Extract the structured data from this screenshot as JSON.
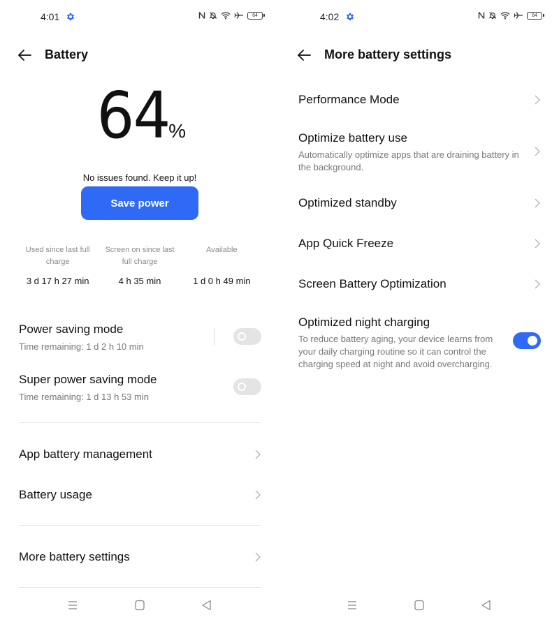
{
  "left": {
    "status": {
      "time": "4:01",
      "battery_level": "64",
      "icons": [
        "settings-gear-icon",
        "nfc-icon",
        "notifications-off-icon",
        "wifi-icon",
        "airplane-mode-icon",
        "battery-icon"
      ]
    },
    "header": {
      "title": "Battery"
    },
    "battery": {
      "percent": "64",
      "percent_sign": "%",
      "status_text": "No issues found. Keep it up!",
      "save_power_label": "Save power"
    },
    "stats": [
      {
        "label": "Used since last full charge",
        "value": "3 d 17 h 27 min"
      },
      {
        "label": "Screen on since last full charge",
        "value": "4 h 35 min"
      },
      {
        "label": "Available",
        "value": "1 d 0 h 49 min"
      }
    ],
    "modes": [
      {
        "title": "Power saving mode",
        "subtitle": "Time remaining:  1 d 2 h 10 min",
        "enabled": false
      },
      {
        "title": "Super power saving mode",
        "subtitle": "Time remaining:  1 d 13 h 53 min",
        "enabled": false
      }
    ],
    "menu": [
      {
        "label": "App battery management"
      },
      {
        "label": "Battery usage"
      },
      {
        "label": "More battery settings"
      }
    ]
  },
  "right": {
    "status": {
      "time": "4:02",
      "battery_level": "64"
    },
    "header": {
      "title": "More battery settings"
    },
    "items": [
      {
        "title": "Performance Mode"
      },
      {
        "title": "Optimize battery use",
        "subtitle": "Automatically optimize apps that are draining battery in the background."
      },
      {
        "title": "Optimized standby"
      },
      {
        "title": "App Quick Freeze"
      },
      {
        "title": "Screen Battery Optimization"
      },
      {
        "title": "Optimized night charging",
        "subtitle": "To reduce battery aging, your device learns from your daily charging routine so it can control the charging speed at night and avoid overcharging.",
        "enabled": true
      }
    ]
  },
  "colors": {
    "accent": "#2e6af5",
    "toggle_off": "#e4e4e4",
    "secondary_text": "#777777"
  }
}
